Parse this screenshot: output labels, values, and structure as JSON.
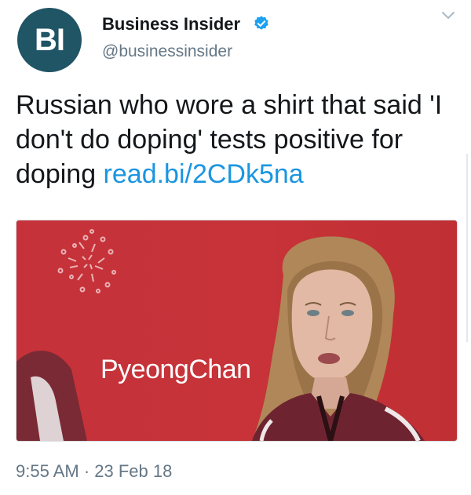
{
  "tweet": {
    "avatar_text": "BI",
    "name": "Business Insider",
    "handle": "@businessinsider",
    "text": "Russian who wore a shirt that said 'I don't do doping' tests positive for doping ",
    "link": "read.bi/2CDk5na",
    "media_caption": "PyeongChan",
    "timestamp": "9:55 AM · 23 Feb 18"
  },
  "icons": {
    "verified": "verified-badge-icon",
    "caret": "chevron-down-icon"
  },
  "colors": {
    "avatar_bg": "#1f5565",
    "link": "#1b95e0",
    "verified": "#1da1f2",
    "muted": "#657786",
    "media_bg": "#c5323a"
  }
}
